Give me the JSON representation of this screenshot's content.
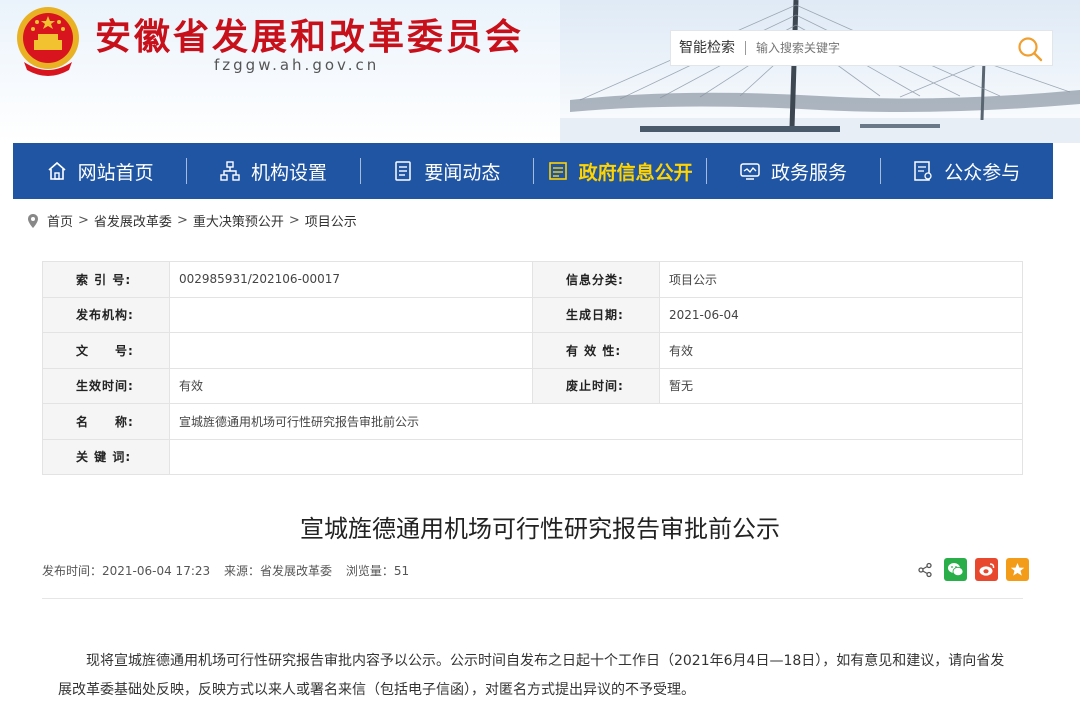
{
  "site": {
    "title": "安徽省发展和改革委员会",
    "domain": "fzggw.ah.gov.cn"
  },
  "search": {
    "label": "智能检索",
    "placeholder": "输入搜索关键字"
  },
  "nav": {
    "items": [
      {
        "label": "网站首页",
        "icon": "home-icon",
        "active": false
      },
      {
        "label": "机构设置",
        "icon": "org-chart-icon",
        "active": false
      },
      {
        "label": "要闻动态",
        "icon": "news-icon",
        "active": false
      },
      {
        "label": "政府信息公开",
        "icon": "document-icon",
        "active": true
      },
      {
        "label": "政务服务",
        "icon": "monitor-icon",
        "active": false
      },
      {
        "label": "公众参与",
        "icon": "form-icon",
        "active": false
      }
    ]
  },
  "breadcrumb": [
    "首页",
    "省发展改革委",
    "重大决策预公开",
    "项目公示"
  ],
  "info": {
    "rows": [
      {
        "k1": "索 引 号:",
        "v1": "002985931/202106-00017",
        "k2": "信息分类:",
        "v2": "项目公示"
      },
      {
        "k1": "发布机构:",
        "v1": "",
        "k2": "生成日期:",
        "v2": "2021-06-04"
      },
      {
        "k1": "文　　号:",
        "v1": "",
        "k2": "有 效 性:",
        "v2": "有效"
      },
      {
        "k1": "生效时间:",
        "v1": "有效",
        "k2": "废止时间:",
        "v2": "暂无"
      }
    ],
    "name_label": "名　　称:",
    "name_value": "宣城旌德通用机场可行性研究报告审批前公示",
    "keywords_label": "关 键 词:",
    "keywords_value": ""
  },
  "article": {
    "title": "宣城旌德通用机场可行性研究报告审批前公示",
    "publish_time": "发布时间：2021-06-04 17:23",
    "source": "来源：省发展改革委",
    "views": "浏览量：51",
    "body": "现将宣城旌德通用机场可行性研究报告审批内容予以公示。公示时间自发布之日起十个工作日（2021年6月4日—18日），如有意见和建议，请向省发展改革委基础处反映，反映方式以来人或署名来信（包括电子信函），对匿名方式提出异议的不予受理。"
  },
  "colors": {
    "brand_red": "#c8101a",
    "nav_blue": "#1f55a3",
    "nav_active": "#ffd400"
  }
}
